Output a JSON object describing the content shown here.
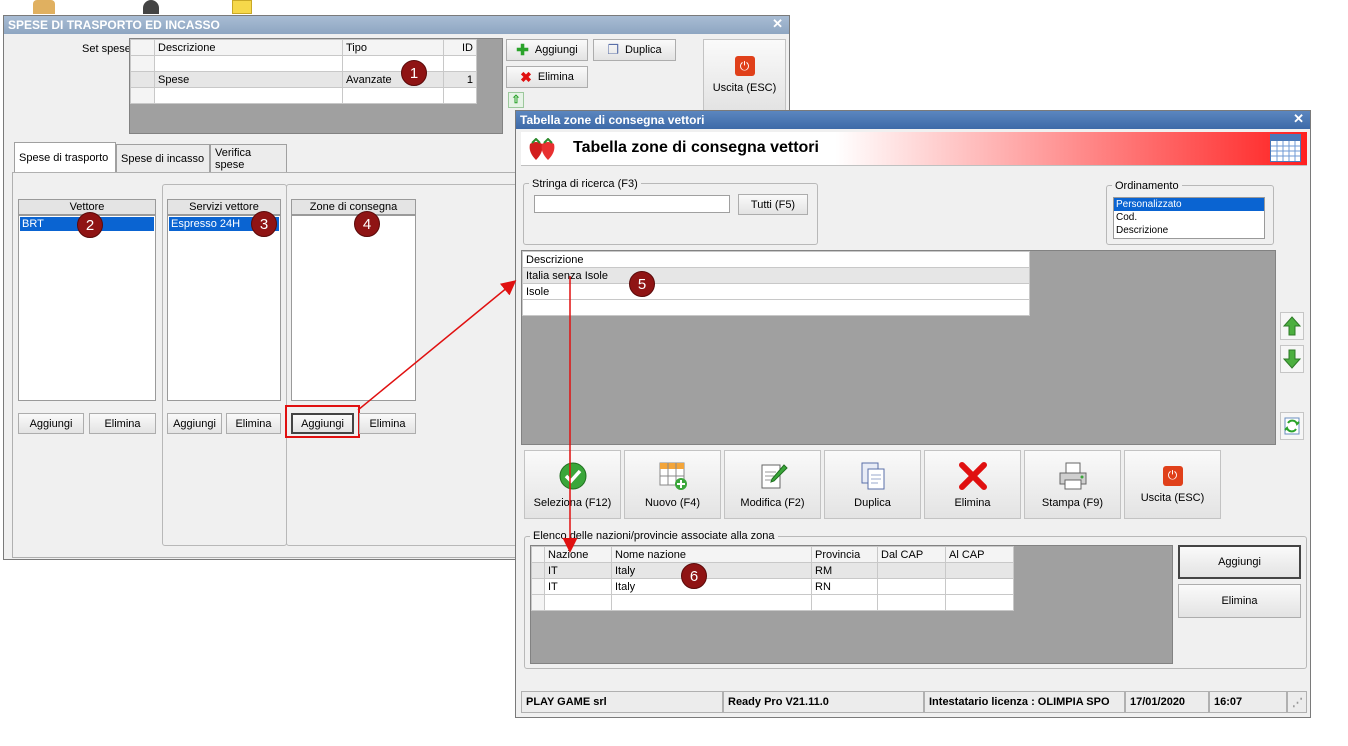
{
  "main_window": {
    "title": "SPESE DI TRASPORTO ED INCASSO",
    "set_label": "Set spese :",
    "set_table": {
      "columns": [
        "Descrizione",
        "Tipo",
        "ID"
      ],
      "rows": [
        [
          "Spese",
          "Avanzate",
          "1"
        ]
      ]
    },
    "buttons": {
      "add": "Aggiungi",
      "duplicate": "Duplica",
      "delete": "Elimina",
      "exit": "Uscita (ESC)"
    },
    "tabs": [
      "Spese di trasporto",
      "Spese di incasso",
      "Verifica spese"
    ],
    "carrier_header": "Vettore",
    "carrier_items": [
      "BRT"
    ],
    "services_header": "Servizi vettore",
    "services_items": [
      "Espresso 24H"
    ],
    "zones_header": "Zone di consegna",
    "add_label": "Aggiungi",
    "delete_label": "Elimina"
  },
  "zones_window": {
    "title": "Tabella zone di consegna vettori",
    "banner_title": "Tabella zone di consegna vettori",
    "search_label": "Stringa di ricerca (F3)",
    "search_value": "",
    "all_button": "Tutti (F5)",
    "sort_label": "Ordinamento",
    "sort_options": [
      "Personalizzato",
      "Cod.",
      "Descrizione"
    ],
    "zones_table": {
      "header": "Descrizione",
      "rows": [
        "Italia senza Isole",
        "Isole"
      ]
    },
    "actions": {
      "select": "Seleziona (F12)",
      "new": "Nuovo (F4)",
      "edit": "Modifica (F2)",
      "duplicate": "Duplica",
      "delete": "Elimina",
      "print": "Stampa (F9)",
      "exit": "Uscita (ESC)"
    },
    "nations_label": "Elenco delle nazioni/provincie associate alla zona",
    "nations_table": {
      "columns": [
        "Nazione",
        "Nome nazione",
        "Provincia",
        "Dal CAP",
        "Al CAP"
      ],
      "rows": [
        [
          "IT",
          "Italy",
          "RM",
          "",
          ""
        ],
        [
          "IT",
          "Italy",
          "RN",
          "",
          ""
        ]
      ]
    },
    "nations_add": "Aggiungi",
    "nations_delete": "Elimina",
    "status": {
      "company": "PLAY GAME srl",
      "version": "Ready Pro V21.11.0",
      "license": "Intestatario licenza : OLIMPIA SPO",
      "date": "17/01/2020",
      "time": "16:07"
    }
  },
  "badges": [
    "1",
    "2",
    "3",
    "4",
    "5",
    "6"
  ],
  "colors": {
    "accent_red": "#e01010",
    "badge": "#8f1414",
    "selection": "#0a64d2",
    "banner_gradient_end": "#ff2020"
  }
}
